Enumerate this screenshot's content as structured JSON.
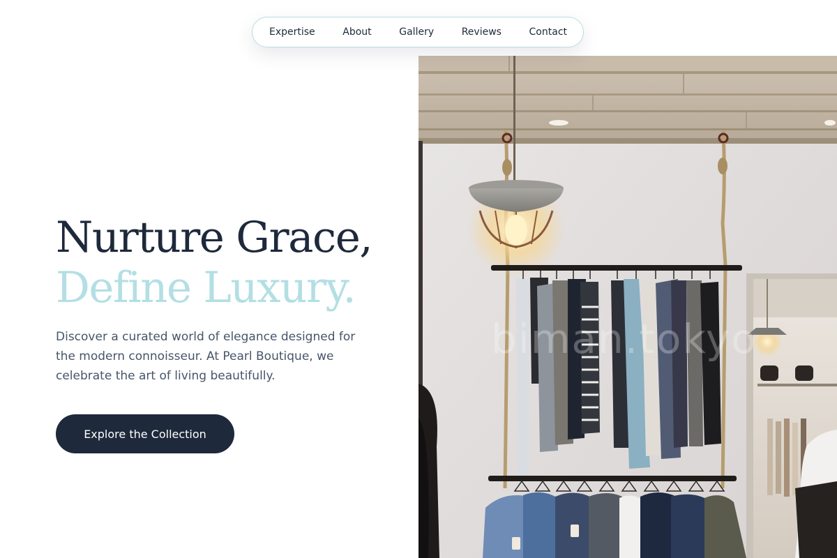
{
  "nav": {
    "items": [
      {
        "label": "Expertise"
      },
      {
        "label": "About"
      },
      {
        "label": "Gallery"
      },
      {
        "label": "Reviews"
      },
      {
        "label": "Contact"
      }
    ]
  },
  "hero": {
    "headline_line1": "Nurture Grace,",
    "headline_line2": "Define Luxury.",
    "description": "Discover a curated world of elegance designed for the modern connoisseur. At Pearl Boutique, we celebrate the art of living beautifully.",
    "cta_label": "Explore the Collection"
  },
  "image": {
    "watermark": "biman.tokyo"
  },
  "colors": {
    "primary_dark": "#1e293b",
    "accent_light_blue": "#b3dfe4",
    "body_text": "#475569",
    "nav_border": "#b9dde2"
  }
}
